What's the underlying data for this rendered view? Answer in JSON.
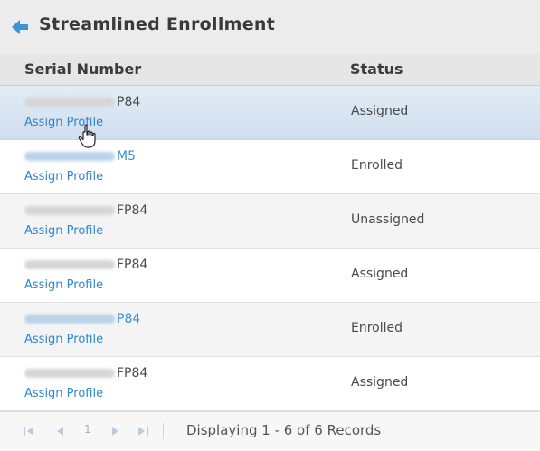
{
  "header": {
    "title": "Streamlined Enrollment",
    "back_icon": "arrow-left-icon"
  },
  "table": {
    "columns": [
      "Serial Number",
      "Status"
    ],
    "rows": [
      {
        "serial_suffix": "P84",
        "link": "Assign Profile",
        "status": "Assigned",
        "selected": true
      },
      {
        "serial_suffix": "M5",
        "link": "Assign Profile",
        "status": "Enrolled",
        "selected": false
      },
      {
        "serial_suffix": "FP84",
        "link": "Assign Profile",
        "status": "Unassigned",
        "selected": false
      },
      {
        "serial_suffix": "FP84",
        "link": "Assign Profile",
        "status": "Assigned",
        "selected": false
      },
      {
        "serial_suffix": "P84",
        "link": "Assign Profile",
        "status": "Enrolled",
        "selected": false
      },
      {
        "serial_suffix": "FP84",
        "link": "Assign Profile",
        "status": "Assigned",
        "selected": false
      }
    ]
  },
  "pager": {
    "page": "1",
    "text": "Displaying 1 - 6 of 6 Records"
  },
  "colors": {
    "accent": "#2f86cf",
    "selected_row": "#d8e5f2",
    "header_bg": "#ececec"
  }
}
